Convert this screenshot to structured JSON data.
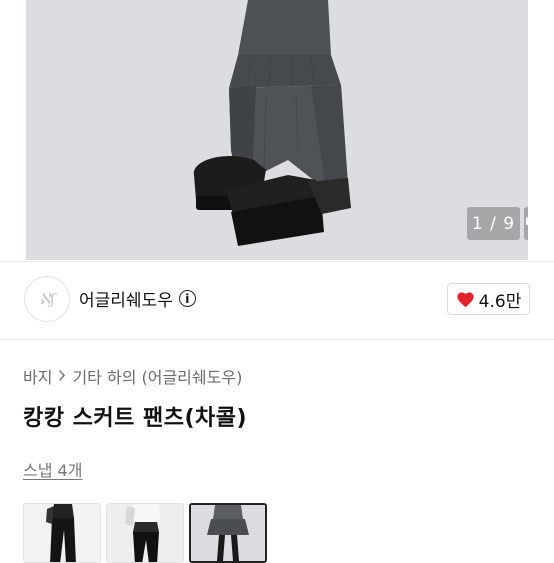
{
  "gallery": {
    "counter_text": "1 / 9",
    "current_index": 1,
    "total": 9
  },
  "shop": {
    "logo_text": "ℵʃ",
    "name": "어글리쉐도우",
    "info_icon": "info-circle-icon"
  },
  "like": {
    "icon": "heart-icon",
    "color": "#e2222c",
    "count": "4.6만"
  },
  "breadcrumb": {
    "category": "바지",
    "separator": ">",
    "subcategory": "기타 하의 (어글리쉐도우)"
  },
  "product": {
    "title": "캉캉 스커트 팬츠(차콜)"
  },
  "snap": {
    "label": "스냅 4개"
  },
  "thumbnails": [
    {
      "name": "snap-1",
      "selected": false
    },
    {
      "name": "snap-2",
      "selected": false
    },
    {
      "name": "snap-3",
      "selected": true
    }
  ],
  "colors": {
    "hero_background": "#dcdde0",
    "garment": "#4a4d52",
    "shoes": "#1b1b1b"
  }
}
